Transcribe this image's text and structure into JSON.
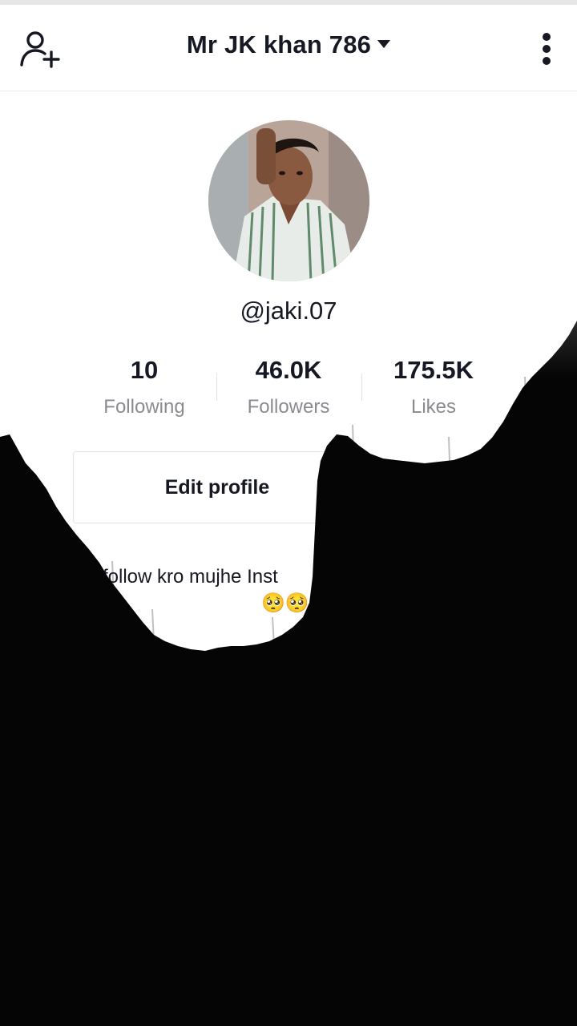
{
  "header": {
    "title": "Mr JK khan 786"
  },
  "profile": {
    "handle": "@jaki.07"
  },
  "stats": [
    {
      "value": "10",
      "label": "Following"
    },
    {
      "value": "46.0K",
      "label": "Followers"
    },
    {
      "value": "175.5K",
      "label": "Likes"
    }
  ],
  "edit_profile_label": "Edit profile",
  "bio": {
    "text": "follow kro mujhe Inst",
    "emojis": "🥺🥺"
  },
  "icons": [
    "add-user-icon",
    "caret-down-icon",
    "more-vertical-icon"
  ],
  "colors": {
    "text": "#161823",
    "secondary": "#8a8b91",
    "overlay": "#050505"
  }
}
